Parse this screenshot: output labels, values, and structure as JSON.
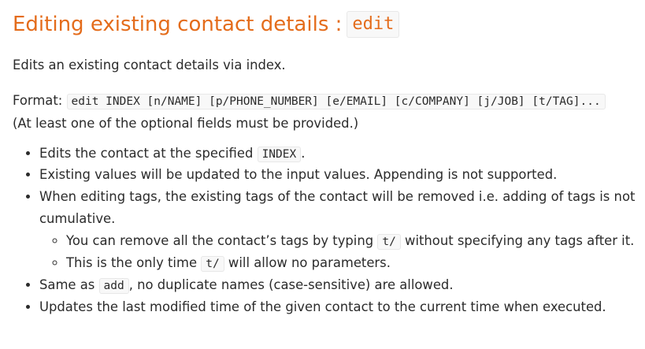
{
  "section": {
    "title": "Editing existing contact details : ",
    "title_code": "edit"
  },
  "description": "Edits an existing contact details via index.",
  "format": {
    "label": "Format: ",
    "command_code": "edit INDEX [n/NAME] [p/PHONE_NUMBER] [e/EMAIL] [c/COMPANY] [j/JOB] [t/TAG]...",
    "note": "(At least one of the optional fields must be provided.)"
  },
  "bullets": {
    "b1": {
      "before": "Edits the contact at the specified ",
      "code": "INDEX",
      "after": "."
    },
    "b2": "Existing values will be updated to the input values. Appending is not supported.",
    "b3": "When editing tags, the existing tags of the contact will be removed i.e. adding of tags is not cumulative.",
    "b3_sub": {
      "s1": {
        "before": "You can remove all the contact’s tags by typing ",
        "code": "t/",
        "after": " without specifying any tags after it."
      },
      "s2": {
        "before": "This is the only time ",
        "code": "t/",
        "after": " will allow no parameters."
      }
    },
    "b4": {
      "before": "Same as ",
      "code": "add",
      "after": ", no duplicate names (case-sensitive) are allowed."
    },
    "b5": "Updates the last modified time of the given contact to the current time when executed."
  },
  "colors": {
    "heading": "#e46c1b",
    "text": "#2b2b2b",
    "code_bg": "#f8f8f8",
    "code_border": "#e8e8e8"
  }
}
